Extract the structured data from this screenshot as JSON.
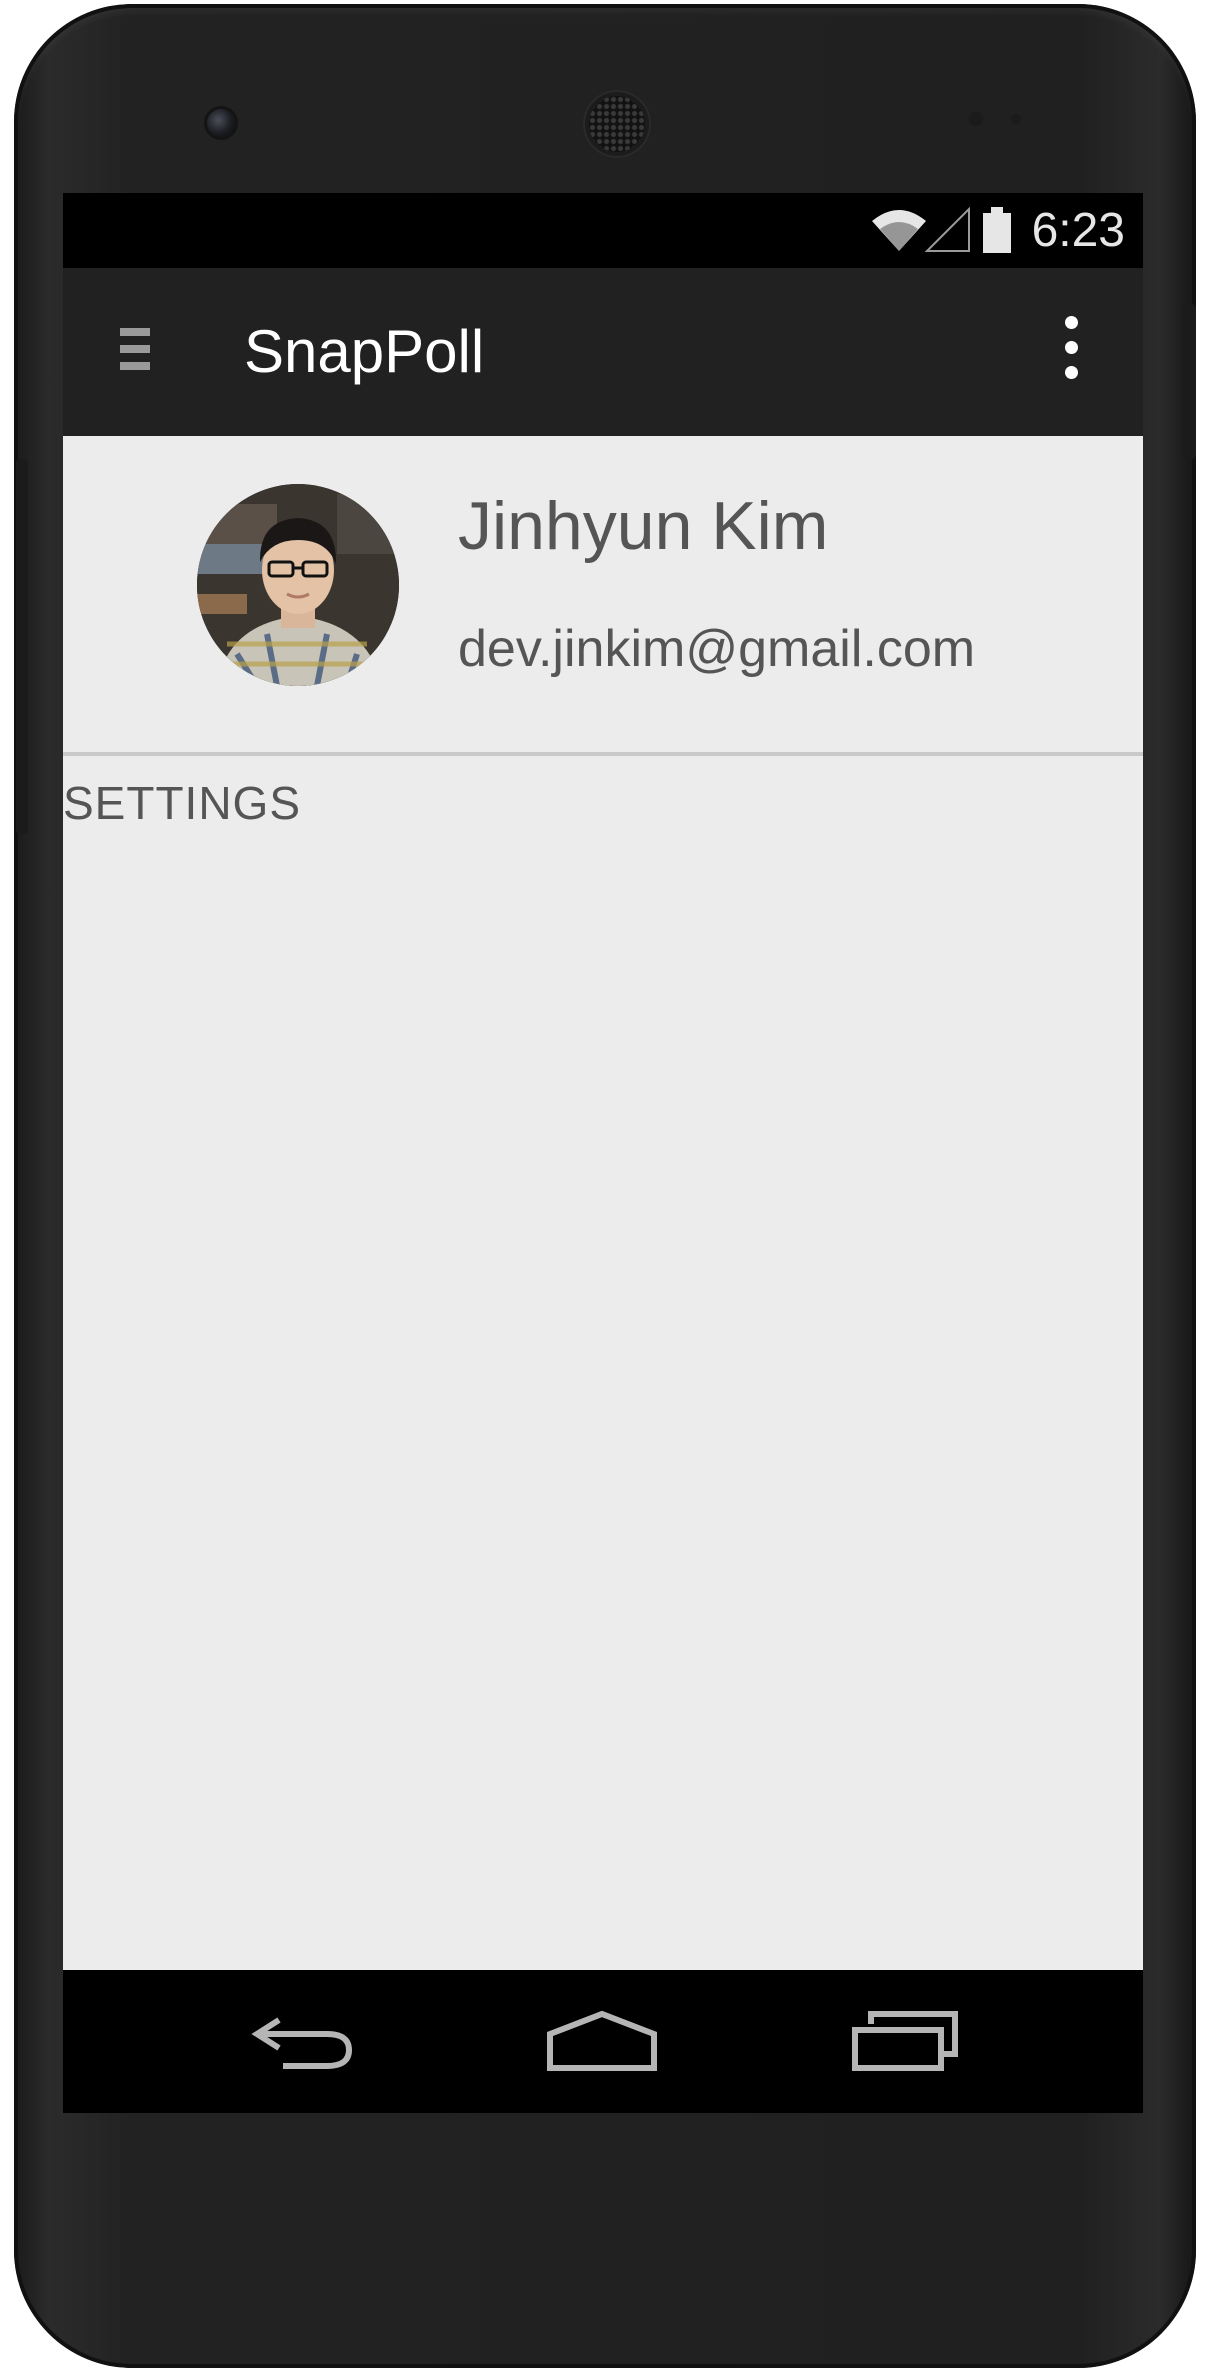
{
  "status_bar": {
    "time": "6:23",
    "icons": [
      "wifi-icon",
      "cell-signal-icon",
      "battery-icon"
    ]
  },
  "action_bar": {
    "title": "SnapPoll",
    "left_icon": "drawer-menu-icon",
    "right_icon": "overflow-menu-icon"
  },
  "profile": {
    "name": "Jinhyun Kim",
    "email": "dev.jinkim@gmail.com",
    "avatar": "profile-photo"
  },
  "drawer": {
    "settings_label": "SETTINGS"
  },
  "nav_bar": {
    "buttons": [
      "back-icon",
      "home-icon",
      "recents-icon"
    ]
  },
  "colors": {
    "action_bar": "#212121",
    "content_bg": "#ececec",
    "text": "#555555",
    "status_bar": "#000000"
  }
}
